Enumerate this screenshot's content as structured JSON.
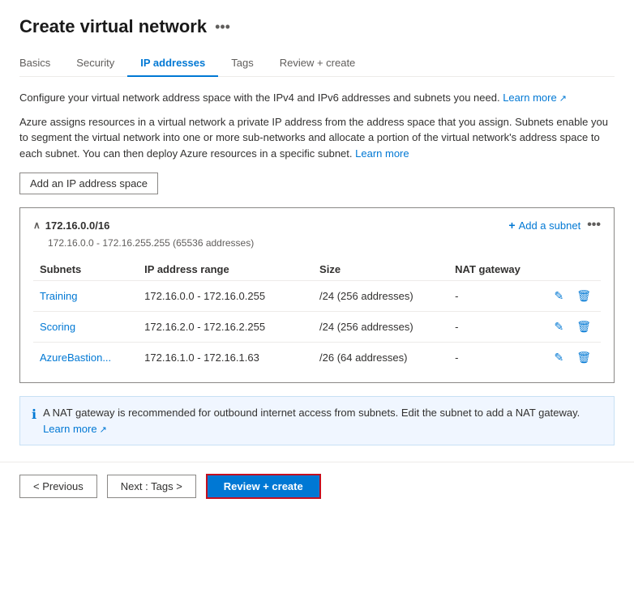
{
  "page": {
    "title": "Create virtual network",
    "more_icon_label": "•••"
  },
  "tabs": [
    {
      "id": "basics",
      "label": "Basics",
      "active": false
    },
    {
      "id": "security",
      "label": "Security",
      "active": false
    },
    {
      "id": "ip-addresses",
      "label": "IP addresses",
      "active": true
    },
    {
      "id": "tags",
      "label": "Tags",
      "active": false
    },
    {
      "id": "review-create",
      "label": "Review + create",
      "active": false
    }
  ],
  "info_line1": "Configure your virtual network address space with the IPv4 and IPv6 addresses and subnets you need.",
  "learn_more_1": "Learn more",
  "info_line2": "Azure assigns resources in a virtual network a private IP address from the address space that you assign. Subnets enable you to segment the virtual network into one or more sub-networks and allocate a portion of the virtual network's address space to each subnet. You can then deploy Azure resources in a specific subnet.",
  "learn_more_2": "Learn more",
  "add_ip_space_btn": "Add an IP address space",
  "ip_space": {
    "cidr": "172.16.0.0/16",
    "range_info": "172.16.0.0 - 172.16.255.255 (65536 addresses)",
    "add_subnet_label": "Add a subnet",
    "more_label": "•••"
  },
  "table": {
    "headers": [
      "Subnets",
      "IP address range",
      "Size",
      "NAT gateway"
    ],
    "rows": [
      {
        "name": "Training",
        "ip_range": "172.16.0.0 - 172.16.0.255",
        "size": "/24 (256 addresses)",
        "nat": "-"
      },
      {
        "name": "Scoring",
        "ip_range": "172.16.2.0 - 172.16.2.255",
        "size": "/24 (256 addresses)",
        "nat": "-"
      },
      {
        "name": "AzureBastion...",
        "ip_range": "172.16.1.0 - 172.16.1.63",
        "size": "/26 (64 addresses)",
        "nat": "-"
      }
    ]
  },
  "nat_notice": "A NAT gateway is recommended for outbound internet access from subnets. Edit the subnet to add a NAT gateway.",
  "learn_more_3": "Learn more",
  "footer": {
    "previous_btn": "< Previous",
    "next_btn": "Next : Tags >",
    "review_create_btn": "Review + create"
  }
}
